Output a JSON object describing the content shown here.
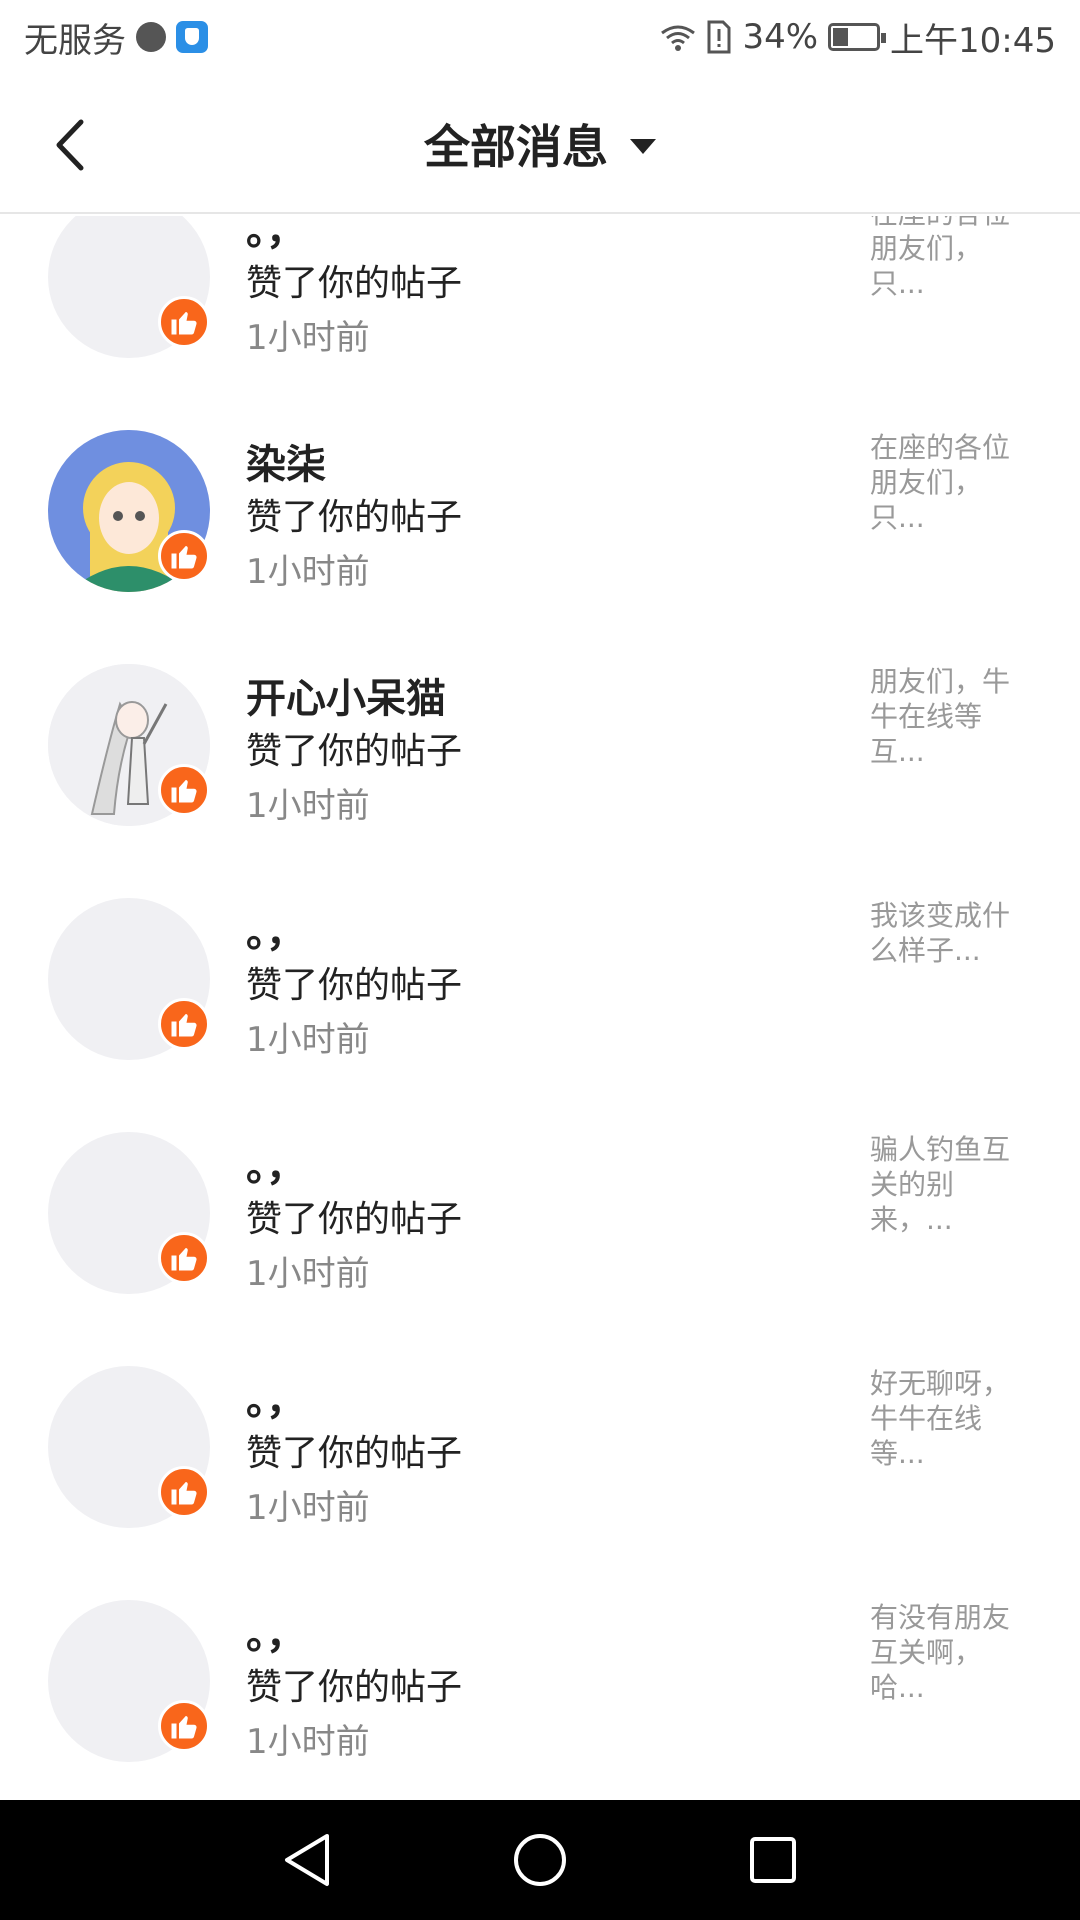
{
  "status_bar": {
    "carrier": "无服务",
    "battery": "34%",
    "battery_level": 0.34,
    "time": "上午10:45"
  },
  "header": {
    "title": "全部消息"
  },
  "notifications": [
    {
      "name": "。，",
      "action": "赞了你的帖子",
      "time": "1小时前",
      "snippet": "在座的各位朋友们，只..."
    },
    {
      "name": "染柒",
      "action": "赞了你的帖子",
      "time": "1小时前",
      "snippet": "在座的各位朋友们，只..."
    },
    {
      "name": "开心小呆猫",
      "action": "赞了你的帖子",
      "time": "1小时前",
      "snippet": "朋友们，牛牛在线等互..."
    },
    {
      "name": "。，",
      "action": "赞了你的帖子",
      "time": "1小时前",
      "snippet": "我该变成什么样子..."
    },
    {
      "name": "。，",
      "action": "赞了你的帖子",
      "time": "1小时前",
      "snippet": "骗人钓鱼互关的别来，..."
    },
    {
      "name": "。，",
      "action": "赞了你的帖子",
      "time": "1小时前",
      "snippet": "好无聊呀，牛牛在线等..."
    },
    {
      "name": "。，",
      "action": "赞了你的帖子",
      "time": "1小时前",
      "snippet": "有没有朋友互关啊，哈..."
    }
  ],
  "colors": {
    "accent": "#f9661b",
    "avatar_placeholder": "#f0f0f3",
    "nav_bg": "#000000"
  }
}
